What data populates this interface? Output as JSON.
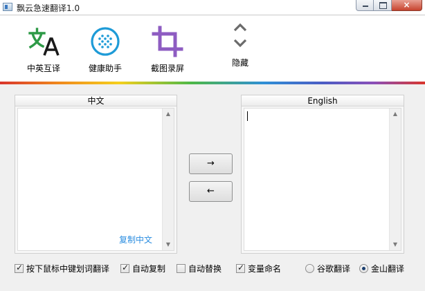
{
  "window": {
    "title": "飘云急速翻译1.0",
    "close_label": "×"
  },
  "toolbar": {
    "translate": {
      "label": "中英互译",
      "icon": "translate-icon"
    },
    "health": {
      "label": "健康助手",
      "icon": "grid-circle-icon"
    },
    "screenshot": {
      "label": "截图录屏",
      "icon": "crop-icon"
    },
    "hide": {
      "label": "隐藏",
      "icon": "chevron-up-down-icon"
    }
  },
  "left_panel": {
    "header": "中文",
    "text": "",
    "copy_link": "复制中文"
  },
  "right_panel": {
    "header": "English",
    "text": ""
  },
  "buttons": {
    "to_english": "→",
    "to_chinese": "←"
  },
  "options": {
    "mouse_select_translate": {
      "label": "按下鼠标中键划词翻译",
      "checked": true
    },
    "auto_copy": {
      "label": "自动复制",
      "checked": true
    },
    "auto_replace": {
      "label": "自动替换",
      "checked": false
    },
    "variable_naming": {
      "label": "变量命名",
      "checked": true
    },
    "google_translate": {
      "label": "谷歌翻译",
      "selected": false
    },
    "kingsoft_translate": {
      "label": "金山翻译",
      "selected": true
    }
  },
  "colors": {
    "translate_green": "#2e9a47",
    "health_blue": "#1e9bd7",
    "crop_purple": "#8e5cc2",
    "link_blue": "#2b8de0"
  }
}
